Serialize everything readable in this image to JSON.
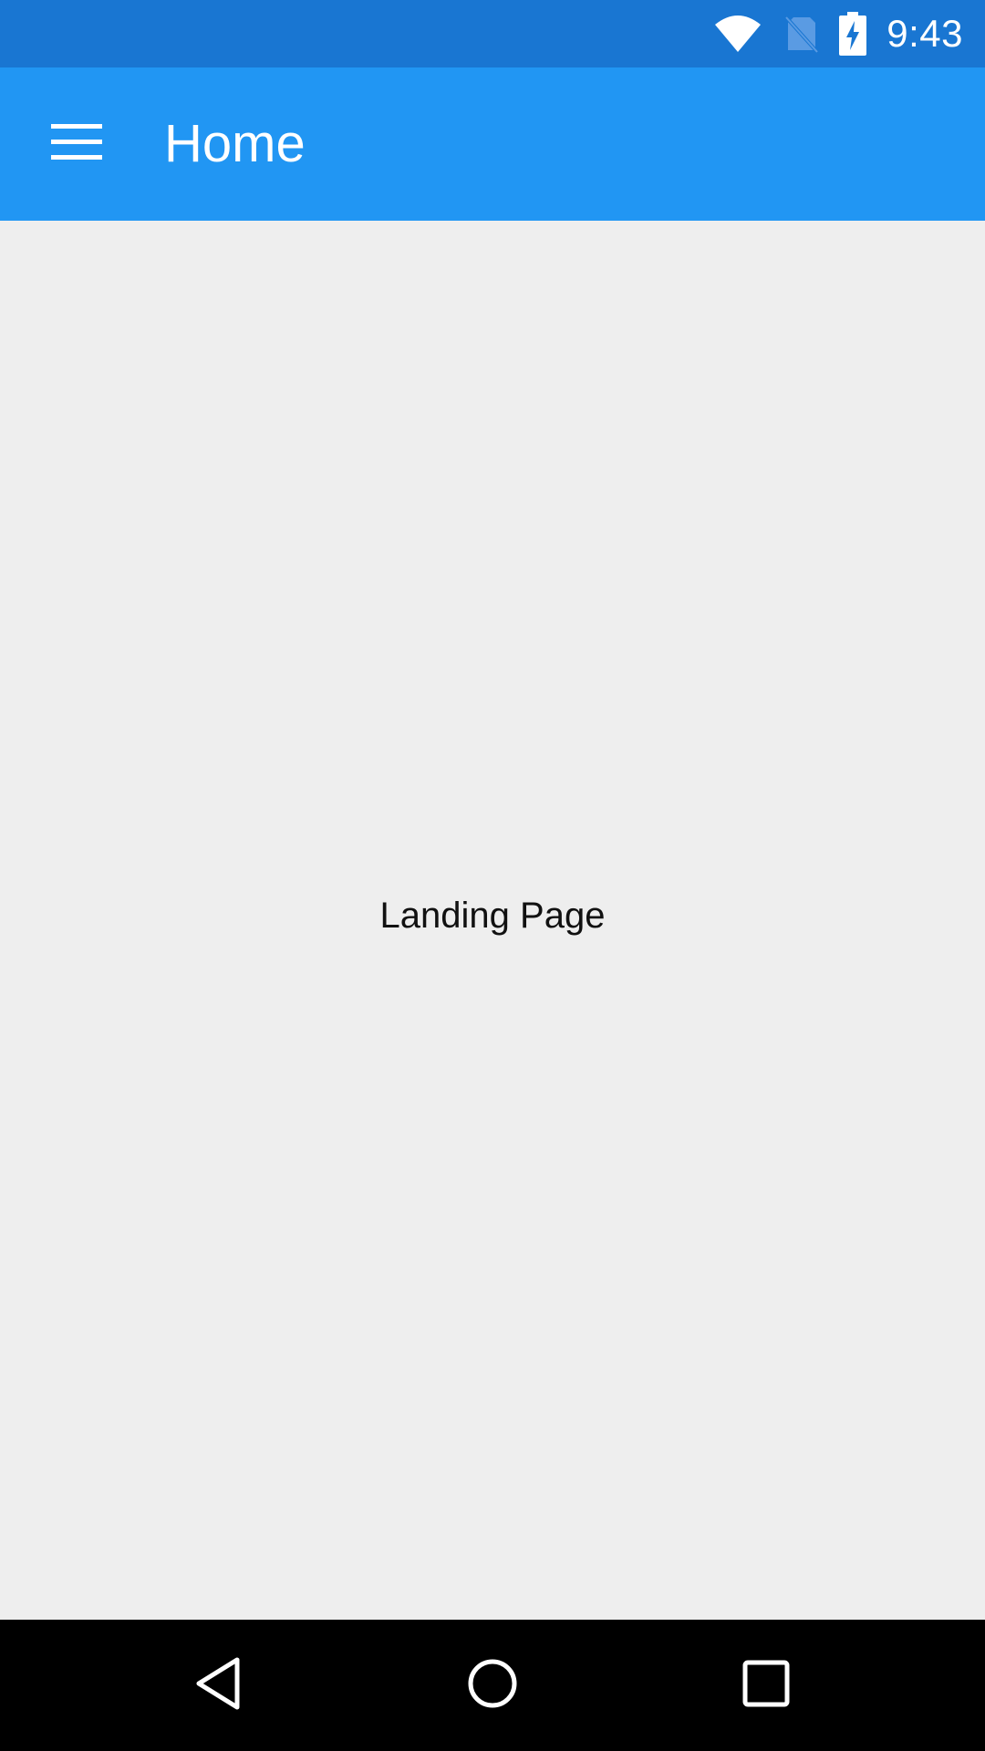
{
  "status_bar": {
    "time": "9:43",
    "icons": [
      "wifi-icon",
      "no-sim-icon",
      "battery-charging-icon"
    ],
    "color": "#1976d2"
  },
  "app_bar": {
    "title": "Home",
    "menu_icon": "hamburger-menu-icon",
    "color": "#2196f3"
  },
  "content": {
    "text": "Landing Page",
    "background": "#eeeeee"
  },
  "nav_bar": {
    "buttons": [
      "back-icon",
      "home-icon",
      "recents-icon"
    ]
  }
}
